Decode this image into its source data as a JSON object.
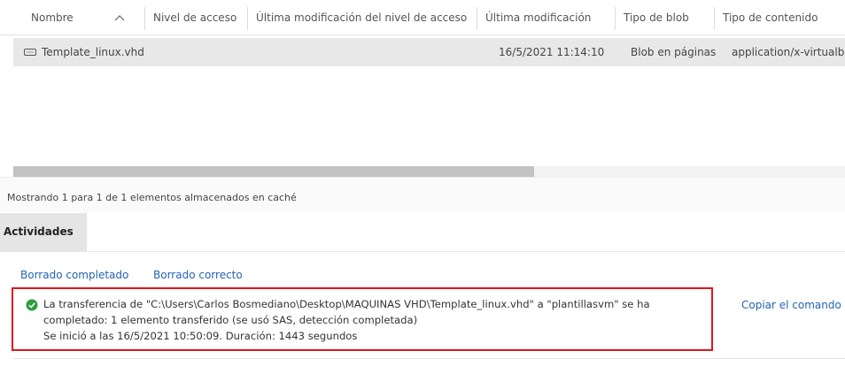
{
  "table": {
    "columns": [
      {
        "label": "Nombre"
      },
      {
        "label": "Nivel de acceso"
      },
      {
        "label": "Última modificación del nivel de acceso"
      },
      {
        "label": "Última modificación"
      },
      {
        "label": "Tipo de blob"
      },
      {
        "label": "Tipo de contenido"
      }
    ],
    "rows": [
      {
        "name": "Template_linux.vhd",
        "access_level": "",
        "access_level_modified": "",
        "last_modified": "16/5/2021 11:14:10",
        "blob_type": "Blob en páginas",
        "content_type": "application/x-virtualb"
      }
    ],
    "scroll_position_fraction": 0.62
  },
  "status": {
    "text": "Mostrando 1 para 1 de 1 elementos almacenados en caché"
  },
  "activities": {
    "tab_label": "Actividades",
    "clear_completed": "Borrado completado",
    "clear_successful": "Borrado correcto",
    "message": {
      "line1": "La transferencia de \"C:\\Users\\Carlos Bosmediano\\Desktop\\MAQUINAS VHD\\Template_linux.vhd\" a \"plantillasvm\" se ha",
      "line2": "completado: 1 elemento transferido (se usó SAS, detección completada)",
      "line3": "Se inició a las 16/5/2021 10:50:09. Duración: 1443 segundos"
    },
    "copy_command": "Copiar el comando"
  },
  "colors": {
    "accent_link": "#2463b4",
    "highlight_border": "#e0161b",
    "success_green": "#2e9e3a",
    "selected_row": "#e8e8e8"
  },
  "icons": [
    "sort-ascending-icon",
    "file-icon",
    "success-check-icon"
  ]
}
